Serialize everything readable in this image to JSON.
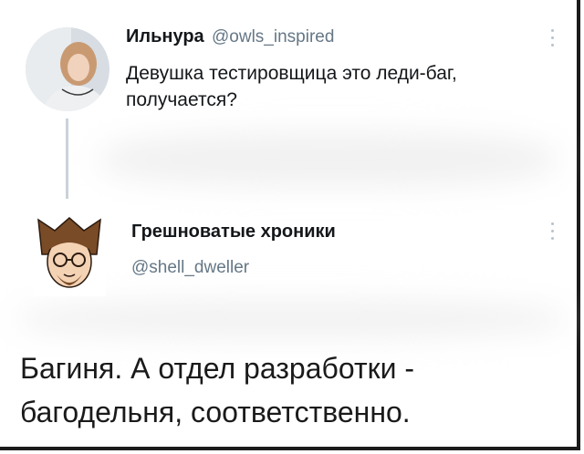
{
  "tweet1": {
    "author_name": "Ильнура",
    "handle": "@owls_inspired",
    "text": "Девушка тестировщица это леди-баг, получается?"
  },
  "tweet2": {
    "author_name": "Грешноватые хроники",
    "handle": "@shell_dweller",
    "text": "Багиня. А отдел разработки - багодельня, соответственно."
  },
  "icons": {
    "more": "more-options-icon"
  }
}
